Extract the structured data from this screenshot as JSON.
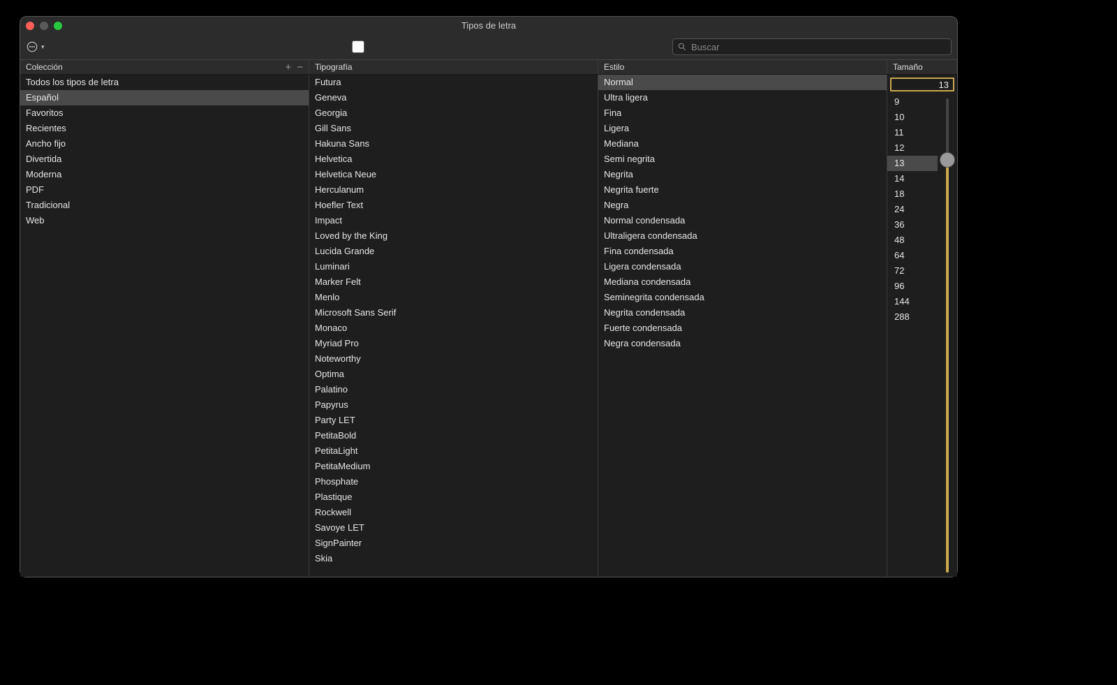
{
  "window_title": "Tipos de letra",
  "search_placeholder": "Buscar",
  "headers": {
    "collection": "Colección",
    "typeface": "Tipografía",
    "style": "Estilo",
    "size": "Tamaño"
  },
  "collections": [
    "Todos los tipos de letra",
    "Español",
    "Favoritos",
    "Recientes",
    "Ancho fijo",
    "Divertida",
    "Moderna",
    "PDF",
    "Tradicional",
    "Web"
  ],
  "collection_selected_index": 1,
  "typefaces": [
    "Futura",
    "Geneva",
    "Georgia",
    "Gill Sans",
    "Hakuna Sans",
    "Helvetica",
    "Helvetica Neue",
    "Herculanum",
    "Hoefler Text",
    "Impact",
    "Loved by the King",
    "Lucida Grande",
    "Luminari",
    "Marker Felt",
    "Menlo",
    "Microsoft Sans Serif",
    "Monaco",
    "Myriad Pro",
    "Noteworthy",
    "Optima",
    "Palatino",
    "Papyrus",
    "Party LET",
    "PetitaBold",
    "PetitaLight",
    "PetitaMedium",
    "Phosphate",
    "Plastique",
    "Rockwell",
    "Savoye LET",
    "SignPainter",
    "Skia"
  ],
  "typeface_selected_index": -1,
  "styles": [
    "Normal",
    "Ultra ligera",
    "Fina",
    "Ligera",
    "Mediana",
    "Semi negrita",
    "Negrita",
    "Negrita fuerte",
    "Negra",
    "Normal condensada",
    "Ultraligera condensada",
    "Fina condensada",
    "Ligera condensada",
    "Mediana condensada",
    "Seminegrita condensada",
    "Negrita condensada",
    "Fuerte condensada",
    "Negra condensada"
  ],
  "style_selected_index": 0,
  "sizes": [
    "9",
    "10",
    "11",
    "12",
    "13",
    "14",
    "18",
    "24",
    "36",
    "48",
    "64",
    "72",
    "96",
    "144",
    "288"
  ],
  "size_selected_index": 4,
  "size_value": "13",
  "slider_percent": 87
}
